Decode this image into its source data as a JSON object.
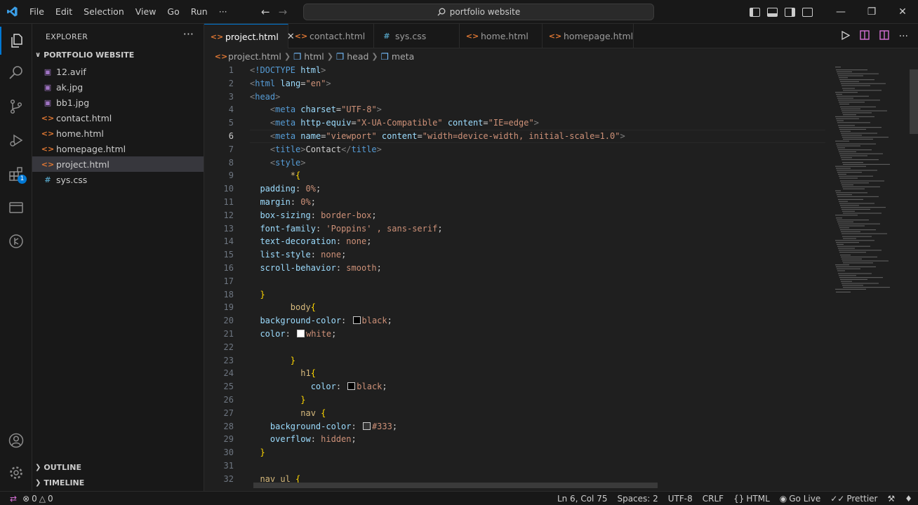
{
  "titlebar": {
    "menu": [
      "File",
      "Edit",
      "Selection",
      "View",
      "Go",
      "Run",
      "···"
    ],
    "search_text": "portfolio website"
  },
  "activity_bar": {
    "extensions_badge": "1"
  },
  "explorer": {
    "title": "EXPLORER",
    "folder": "PORTFOLIO WEBSITE",
    "files": [
      {
        "name": "12.avif",
        "type": "img"
      },
      {
        "name": "ak.jpg",
        "type": "img"
      },
      {
        "name": "bb1.jpg",
        "type": "img"
      },
      {
        "name": "contact.html",
        "type": "html"
      },
      {
        "name": "home.html",
        "type": "html"
      },
      {
        "name": "homepage.html",
        "type": "html"
      },
      {
        "name": "project.html",
        "type": "html"
      },
      {
        "name": "sys.css",
        "type": "css"
      }
    ],
    "selected_file": "project.html",
    "outline_label": "OUTLINE",
    "timeline_label": "TIMELINE"
  },
  "tabs": [
    {
      "label": "project.html",
      "type": "html",
      "active": true
    },
    {
      "label": "contact.html",
      "type": "html",
      "active": false
    },
    {
      "label": "sys.css",
      "type": "css",
      "active": false
    },
    {
      "label": "home.html",
      "type": "html",
      "active": false
    },
    {
      "label": "homepage.html",
      "type": "html",
      "active": false
    }
  ],
  "breadcrumb": [
    "project.html",
    "html",
    "head",
    "meta"
  ],
  "editor": {
    "current_line": 6,
    "lines": [
      "<!DOCTYPE html>",
      "<html lang=\"en\">",
      "<head>",
      "    <meta charset=\"UTF-8\">",
      "    <meta http-equiv=\"X-UA-Compatible\" content=\"IE=edge\">",
      "    <meta name=\"viewport\" content=\"width=device-width, initial-scale=1.0\">",
      "    <title>Contact</title>",
      "    <style>",
      "        *{",
      "  padding: 0%;",
      "  margin: 0%;",
      "  box-sizing: border-box;",
      "  font-family: 'Poppins' , sans-serif;",
      "  text-decoration: none;",
      "  list-style: none;",
      "  scroll-behavior: smooth;",
      "",
      "  }",
      "        body{",
      "  background-color: black;",
      "  color: white;",
      "",
      "        }",
      "          h1{",
      "            color: black;",
      "          }",
      "          nav {",
      "    background-color: #333;",
      "    overflow: hidden;",
      "  }",
      "",
      "  nav ul {"
    ],
    "swatch_colors": {
      "black": "#000000",
      "white": "#ffffff",
      "gray": "#333333"
    }
  },
  "statusbar": {
    "errors": "0",
    "warnings": "0",
    "position": "Ln 6, Col 75",
    "spaces": "Spaces: 2",
    "encoding": "UTF-8",
    "eol": "CRLF",
    "language": "HTML",
    "golive": "Go Live",
    "prettier": "Prettier"
  }
}
